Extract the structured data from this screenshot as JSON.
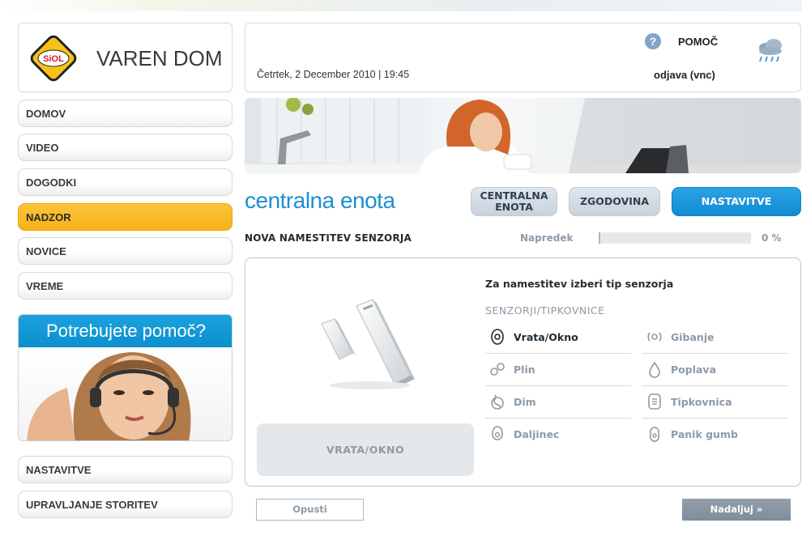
{
  "brand": {
    "logo_text": "SiOL",
    "name": "VAREN DOM"
  },
  "header": {
    "datetime": "Četrtek, 2 December 2010 | 19:45",
    "help_label": "POMOČ",
    "help_icon": "?",
    "logout_label": "odjava (vnc)",
    "weather_icon": "rain-cloud-icon"
  },
  "sidebar": {
    "items": [
      {
        "label": "DOMOV",
        "active": false
      },
      {
        "label": "VIDEO",
        "active": false
      },
      {
        "label": "DOGODKI",
        "active": false
      },
      {
        "label": "NADZOR",
        "active": true
      },
      {
        "label": "NOVICE",
        "active": false
      },
      {
        "label": "VREME",
        "active": false
      }
    ],
    "help_banner_title": "Potrebujete pomoč?",
    "bottom_items": [
      {
        "label": "NASTAVITVE"
      },
      {
        "label": "UPRAVLJANJE STORITEV"
      }
    ]
  },
  "main": {
    "title": "centralna enota",
    "tabs": [
      {
        "label_line1": "CENTRALNA",
        "label_line2": "ENOTA"
      },
      {
        "label": "ZGODOVINA"
      },
      {
        "label": "NASTAVITVE",
        "active": true
      }
    ],
    "section_title": "NOVA NAMESTITEV SENZORJA",
    "progress": {
      "label": "Napredek",
      "value_percent": 0,
      "value_text": "0 %"
    },
    "panel": {
      "selected_caption": "VRATA/OKNO",
      "instruction": "Za namestitev izberi tip senzorja",
      "category": "SENZORJI/TIPKOVNICE",
      "options": [
        {
          "label": "Vrata/Okno",
          "icon": "door-window-sensor-icon",
          "selected": true
        },
        {
          "label": "Gibanje",
          "icon": "motion-sensor-icon",
          "selected": false
        },
        {
          "label": "Plin",
          "icon": "gas-sensor-icon",
          "selected": false
        },
        {
          "label": "Poplava",
          "icon": "flood-sensor-icon",
          "selected": false
        },
        {
          "label": "Dim",
          "icon": "smoke-sensor-icon",
          "selected": false
        },
        {
          "label": "Tipkovnica",
          "icon": "keypad-icon",
          "selected": false
        },
        {
          "label": "Daljinec",
          "icon": "remote-control-icon",
          "selected": false
        },
        {
          "label": "Panik gumb",
          "icon": "panic-button-icon",
          "selected": false
        }
      ]
    },
    "buttons": {
      "cancel": "Opusti",
      "next": "Nadaljuj »"
    }
  },
  "colors": {
    "accent_blue": "#1d8fd2",
    "active_menu": "#f7b21a",
    "muted_text": "#8e9aa6"
  }
}
